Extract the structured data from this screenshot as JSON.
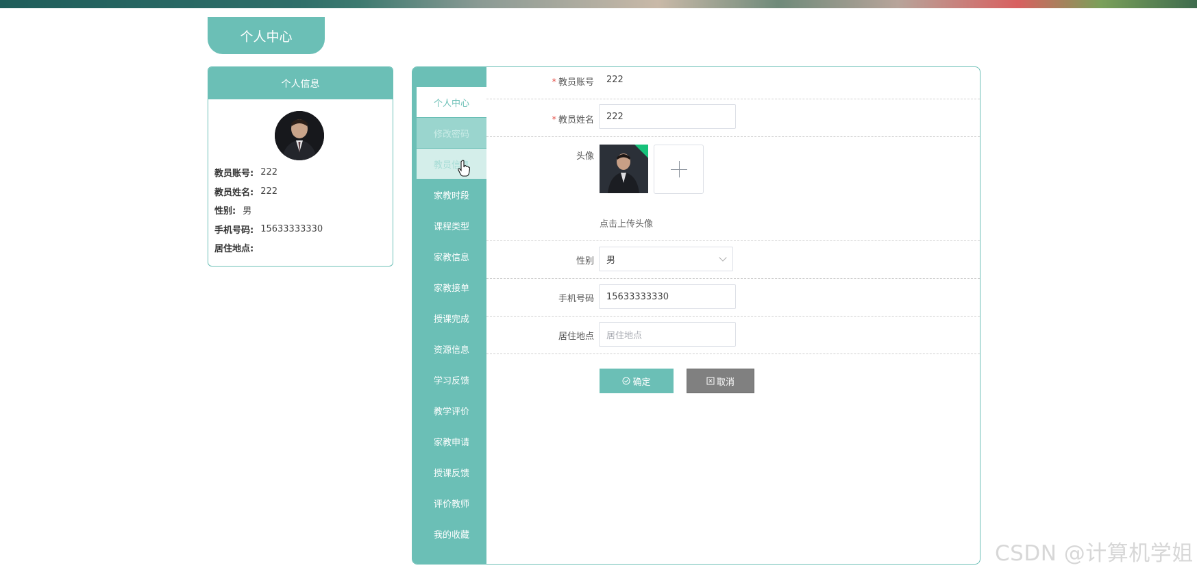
{
  "page_tab": "个人中心",
  "info_card": {
    "header": "个人信息",
    "rows": [
      {
        "label": "教员账号:",
        "value": "222"
      },
      {
        "label": "教员姓名:",
        "value": "222"
      },
      {
        "label": "性别:",
        "value": "男"
      },
      {
        "label": "手机号码:",
        "value": "15633333330"
      },
      {
        "label": "居住地点:",
        "value": ""
      }
    ]
  },
  "nav": {
    "items": [
      "个人中心",
      "修改密码",
      "教员信息",
      "家教时段",
      "课程类型",
      "家教信息",
      "家教接单",
      "授课完成",
      "资源信息",
      "学习反馈",
      "教学评价",
      "家教申请",
      "授课反馈",
      "评价教师",
      "我的收藏"
    ],
    "active_index": 0
  },
  "form": {
    "account_label": "教员账号",
    "account_value": "222",
    "name_label": "教员姓名",
    "name_value": "222",
    "avatar_label": "头像",
    "upload_hint": "点击上传头像",
    "gender_label": "性别",
    "gender_value": "男",
    "phone_label": "手机号码",
    "phone_value": "15633333330",
    "address_label": "居住地点",
    "address_placeholder": "居住地点",
    "confirm_label": "确定",
    "cancel_label": "取消"
  },
  "watermark": "CSDN @计算机学姐",
  "colors": {
    "accent": "#6bbfb6",
    "cancel": "#808080",
    "required": "#e5534b"
  }
}
